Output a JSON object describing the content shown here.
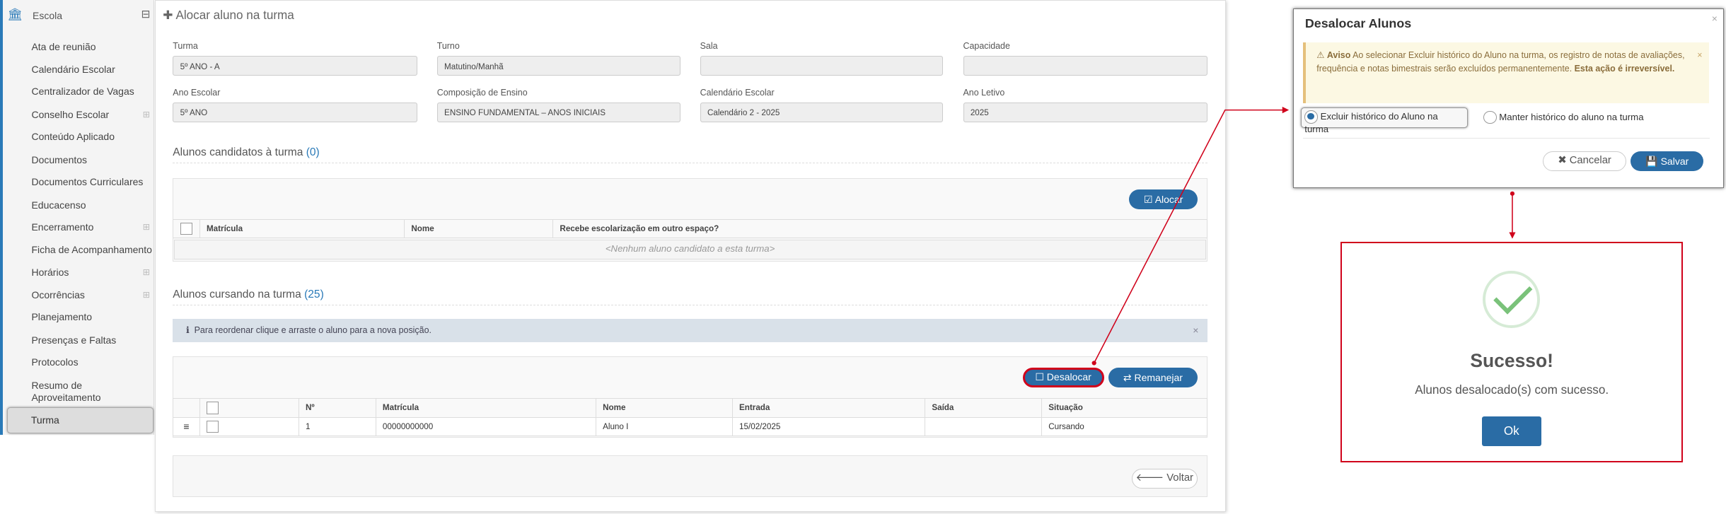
{
  "sidebar": {
    "title": "Escola",
    "icon": "bank-icon",
    "items": [
      {
        "label": "Ata de reunião"
      },
      {
        "label": "Calendário Escolar"
      },
      {
        "label": "Centralizador de Vagas"
      },
      {
        "label": "Conselho Escolar"
      },
      {
        "label": "Conteúdo Aplicado"
      },
      {
        "label": "Documentos"
      },
      {
        "label": "Documentos Curriculares"
      },
      {
        "label": "Educacenso"
      },
      {
        "label": "Encerramento"
      },
      {
        "label": "Ficha de Acompanhamento"
      },
      {
        "label": "Horários"
      },
      {
        "label": "Ocorrências"
      },
      {
        "label": "Planejamento"
      },
      {
        "label": "Presenças e Faltas"
      },
      {
        "label": "Protocolos"
      },
      {
        "label": "Resumo de"
      },
      {
        "label": "Aproveitamento"
      }
    ],
    "active": "Turma"
  },
  "page": {
    "title": "Alocar aluno na turma",
    "fields": {
      "turma_label": "Turma",
      "turma": "5º ANO - A",
      "turno_label": "Turno",
      "turno": "Matutino/Manhã",
      "sala_label": "Sala",
      "sala": "",
      "capacidade_label": "Capacidade",
      "capacidade": "",
      "ano_escolar_label": "Ano Escolar",
      "ano_escolar": "5º ANO",
      "composicao_label": "Composição de Ensino",
      "composicao": "ENSINO FUNDAMENTAL – ANOS INICIAIS",
      "calendario_label": "Calendário Escolar",
      "calendario": "Calendário 2 - 2025",
      "ano_letivo_label": "Ano Letivo",
      "ano_letivo": "2025"
    },
    "candidatos": {
      "title": "Alunos candidatos à turma",
      "count": "(0)",
      "alocar": "Alocar",
      "headers": [
        "Matrícula",
        "Nome",
        "Recebe escolarização em outro espaço?"
      ],
      "empty": "<Nenhum aluno candidato a esta turma>"
    },
    "cursando": {
      "title": "Alunos cursando na turma",
      "count": "(25)",
      "info": "Para reordenar clique e arraste o aluno para a nova posição.",
      "info_close": "×",
      "desalocar": "Desalocar",
      "remanejar": "Remanejar",
      "headers": [
        "Nº",
        "Matrícula",
        "Nome",
        "Entrada",
        "Saída",
        "Situação"
      ],
      "rows": [
        {
          "n": "1",
          "matricula": "00000000000",
          "nome": "Aluno I",
          "entrada": "15/02/2025",
          "saida": "",
          "situacao": "Cursando"
        }
      ]
    },
    "voltar": "Voltar"
  },
  "modal": {
    "title": "Desalocar Alunos",
    "close": "×",
    "warn_strong": "Aviso",
    "warn_text": " Ao selecionar Excluir histórico do Aluno na turma, os registro de notas de avaliações, frequência e notas bimestrais serão excluídos permanentemente. ",
    "warn_strong2": "Esta ação é irreversível.",
    "warn_close": "×",
    "opt1": "Excluir histórico do Aluno na turma",
    "opt2": "Manter histórico do aluno na turma",
    "cancelar": "Cancelar",
    "salvar": "Salvar"
  },
  "success": {
    "title": "Sucesso!",
    "message": "Alunos desalocado(s) com sucesso.",
    "ok": "Ok"
  },
  "colors": {
    "primary": "#2a6ca5",
    "annotation": "#d0021b"
  }
}
